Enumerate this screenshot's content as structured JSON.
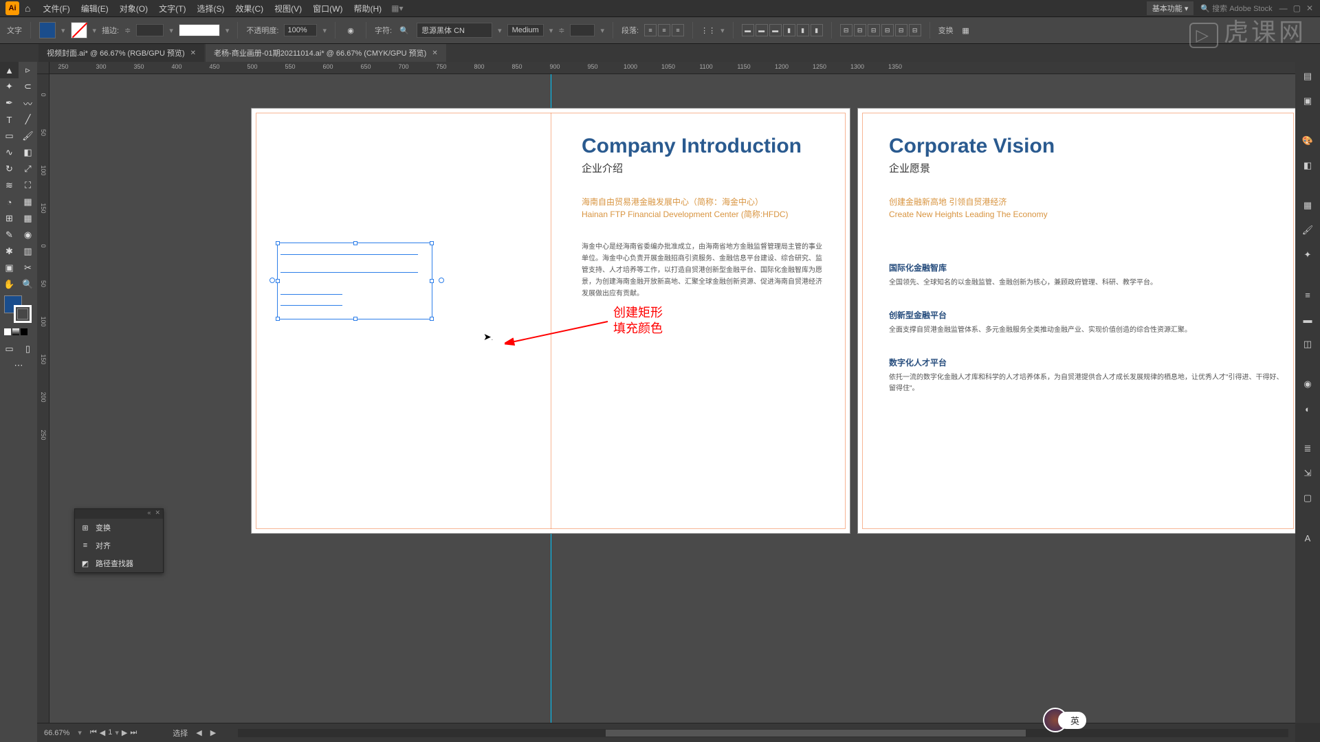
{
  "menubar": {
    "logo": "Ai",
    "items": [
      "文件(F)",
      "编辑(E)",
      "对象(O)",
      "文字(T)",
      "选择(S)",
      "效果(C)",
      "视图(V)",
      "窗口(W)",
      "帮助(H)"
    ],
    "workspace": "基本功能",
    "search_placeholder": "搜索 Adobe Stock"
  },
  "controlbar": {
    "mode_label": "文字",
    "stroke_label": "描边:",
    "stroke_weight": "",
    "opacity_label": "不透明度:",
    "opacity_value": "100%",
    "char_label": "字符:",
    "font_family": "思源黑体 CN",
    "font_weight": "Medium",
    "paragraph_label": "段落:",
    "transform_label": "变换"
  },
  "tabs": [
    {
      "label": "视频封面.ai* @ 66.67% (RGB/GPU 预览)",
      "active": false
    },
    {
      "label": "老杨-商业画册-01期20211014.ai* @ 66.67% (CMYK/GPU 预览)",
      "active": true
    }
  ],
  "ruler_h": [
    "250",
    "300",
    "350",
    "400",
    "450",
    "500",
    "550",
    "600",
    "650",
    "700",
    "750",
    "800",
    "850",
    "900",
    "950",
    "1000",
    "1050",
    "1100",
    "1150",
    "1200",
    "1250",
    "1300",
    "1350"
  ],
  "ruler_v": [
    "0",
    "50",
    "100",
    "150",
    "0",
    "50",
    "100",
    "150",
    "200",
    "250"
  ],
  "artboard1": {
    "title": "Company Introduction",
    "subtitle": "企业介绍",
    "orange_line1": "海南自由贸易港金融发展中心（简称：海金中心）",
    "orange_line2": "Hainan FTP Financial Development Center (简称:HFDC)",
    "body": "海金中心是经海南省委编办批准成立，由海南省地方金融监督管理局主管的事业单位。海金中心负责开展金融招商引资服务、金融信息平台建设、综合研究、监管支持、人才培养等工作，以打造自贸港创新型金融平台、国际化金融智库为愿景，为创建海南金融开放新高地、汇聚全球金融创新资源、促进海南自贸港经济发展做出应有贡献。"
  },
  "annotation": {
    "line1": "创建矩形",
    "line2": "填充颜色"
  },
  "artboard2": {
    "title": "Corporate Vision",
    "subtitle": "企业愿景",
    "orange_line1": "创建金融新高地 引领自贸港经济",
    "orange_line2": "Create New Heights Leading The Economy",
    "sec1_h": "国际化金融智库",
    "sec1_p": "全国领先、全球知名的以金融监管、金融创新为核心，兼顾政府管理、科研、教学平台。",
    "sec2_h": "创新型金融平台",
    "sec2_p": "全面支撑自贸港金融监管体系、多元金融服务全类推动金融产业、实现价值创造的综合性资源汇聚。",
    "sec3_h": "数字化人才平台",
    "sec3_p": "依托一流的数字化金融人才库和科学的人才培养体系，为自贸港提供合人才成长发展规律的栖息地，让优秀人才\"引得进、干得好、留得住\"。"
  },
  "mini_panel": {
    "items": [
      "变换",
      "对齐",
      "路径查找器"
    ]
  },
  "statusbar": {
    "zoom": "66.67%",
    "page": "1",
    "mode": "选择"
  },
  "ime_lang": "英",
  "watermark": "虎课网"
}
